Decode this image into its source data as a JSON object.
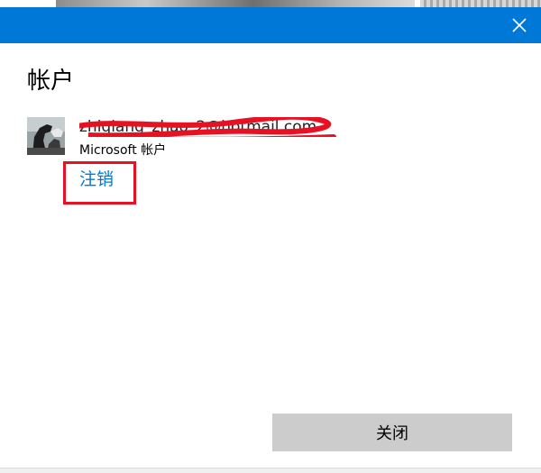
{
  "dialog": {
    "title": "帐户",
    "close_icon": "close-icon",
    "accent_color": "#0078d7"
  },
  "account": {
    "email": "zhiqiang_zhao_2@hotmail.com",
    "email_redacted": true,
    "type": "Microsoft 帐户",
    "sign_out_label": "注销",
    "highlight_color": "#e81123"
  },
  "footer": {
    "close_label": "关闭"
  }
}
